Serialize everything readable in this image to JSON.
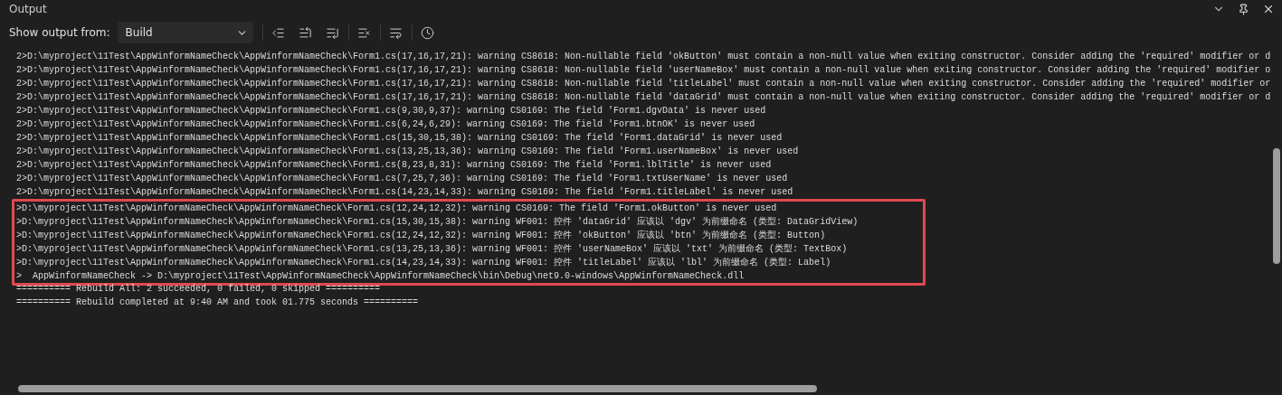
{
  "panel": {
    "title": "Output"
  },
  "toolbar": {
    "label": "Show output from:",
    "source": {
      "value": "Build"
    }
  },
  "output_lines": [
    "2>D:\\myproject\\11Test\\AppWinformNameCheck\\AppWinformNameCheck\\Form1.cs(17,16,17,21): warning CS8618: Non-nullable field 'okButton' must contain a non-null value when exiting constructor. Consider adding the 'required' modifier or d",
    "2>D:\\myproject\\11Test\\AppWinformNameCheck\\AppWinformNameCheck\\Form1.cs(17,16,17,21): warning CS8618: Non-nullable field 'userNameBox' must contain a non-null value when exiting constructor. Consider adding the 'required' modifier o",
    "2>D:\\myproject\\11Test\\AppWinformNameCheck\\AppWinformNameCheck\\Form1.cs(17,16,17,21): warning CS8618: Non-nullable field 'titleLabel' must contain a non-null value when exiting constructor. Consider adding the 'required' modifier or",
    "2>D:\\myproject\\11Test\\AppWinformNameCheck\\AppWinformNameCheck\\Form1.cs(17,16,17,21): warning CS8618: Non-nullable field 'dataGrid' must contain a non-null value when exiting constructor. Consider adding the 'required' modifier or d",
    "2>D:\\myproject\\11Test\\AppWinformNameCheck\\AppWinformNameCheck\\Form1.cs(9,30,9,37): warning CS0169: The field 'Form1.dgvData' is never used",
    "2>D:\\myproject\\11Test\\AppWinformNameCheck\\AppWinformNameCheck\\Form1.cs(6,24,6,29): warning CS0169: The field 'Form1.btnOK' is never used",
    "2>D:\\myproject\\11Test\\AppWinformNameCheck\\AppWinformNameCheck\\Form1.cs(15,30,15,38): warning CS0169: The field 'Form1.dataGrid' is never used",
    "2>D:\\myproject\\11Test\\AppWinformNameCheck\\AppWinformNameCheck\\Form1.cs(13,25,13,36): warning CS0169: The field 'Form1.userNameBox' is never used",
    "2>D:\\myproject\\11Test\\AppWinformNameCheck\\AppWinformNameCheck\\Form1.cs(8,23,8,31): warning CS0169: The field 'Form1.lblTitle' is never used",
    "2>D:\\myproject\\11Test\\AppWinformNameCheck\\AppWinformNameCheck\\Form1.cs(7,25,7,36): warning CS0169: The field 'Form1.txtUserName' is never used",
    "2>D:\\myproject\\11Test\\AppWinformNameCheck\\AppWinformNameCheck\\Form1.cs(14,23,14,33): warning CS0169: The field 'Form1.titleLabel' is never used"
  ],
  "highlighted_lines": [
    ">D:\\myproject\\11Test\\AppWinformNameCheck\\AppWinformNameCheck\\Form1.cs(12,24,12,32): warning CS0169: The field 'Form1.okButton' is never used",
    ">D:\\myproject\\11Test\\AppWinformNameCheck\\AppWinformNameCheck\\Form1.cs(15,30,15,38): warning WF001: 控件 'dataGrid' 应该以 'dgv' 为前缀命名 (类型: DataGridView)",
    ">D:\\myproject\\11Test\\AppWinformNameCheck\\AppWinformNameCheck\\Form1.cs(12,24,12,32): warning WF001: 控件 'okButton' 应该以 'btn' 为前缀命名 (类型: Button)",
    ">D:\\myproject\\11Test\\AppWinformNameCheck\\AppWinformNameCheck\\Form1.cs(13,25,13,36): warning WF001: 控件 'userNameBox' 应该以 'txt' 为前缀命名 (类型: TextBox)",
    ">D:\\myproject\\11Test\\AppWinformNameCheck\\AppWinformNameCheck\\Form1.cs(14,23,14,33): warning WF001: 控件 'titleLabel' 应该以 'lbl' 为前缀命名 (类型: Label)",
    ">  AppWinformNameCheck -> D:\\myproject\\11Test\\AppWinformNameCheck\\AppWinformNameCheck\\bin\\Debug\\net9.0-windows\\AppWinformNameCheck.dll"
  ],
  "summary_lines": [
    "========== Rebuild All: 2 succeeded, 0 failed, 0 skipped ==========",
    "========== Rebuild completed at 9:40 AM and took 01.775 seconds =========="
  ]
}
